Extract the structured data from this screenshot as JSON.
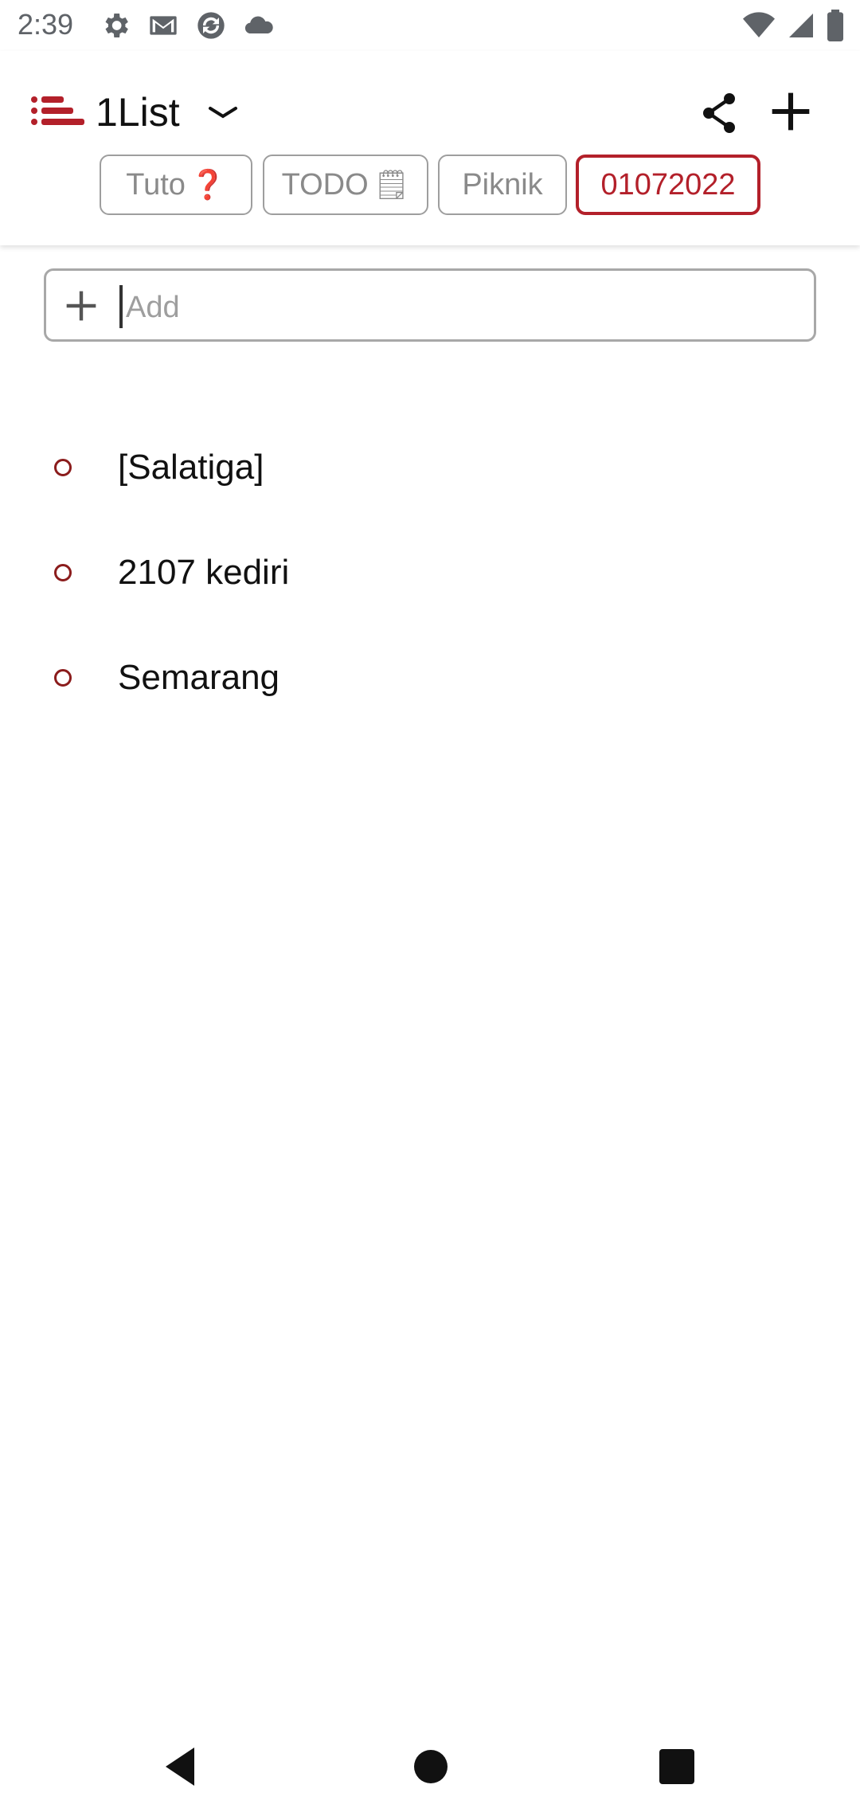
{
  "status_bar": {
    "time": "2:39",
    "icons_left": [
      "settings-icon",
      "gmail-icon",
      "sync-app-icon",
      "cloud-icon"
    ],
    "icons_right": [
      "wifi-icon",
      "signal-icon",
      "battery-icon"
    ]
  },
  "header": {
    "app_title": "1List",
    "menu_icon": "list-menu-icon",
    "accent_color": "#b3202a",
    "tabs": [
      {
        "label": "Tuto",
        "emoji": "❓",
        "active": false
      },
      {
        "label": "TODO",
        "emoji": "🗒",
        "active": false
      },
      {
        "label": "Piknik",
        "emoji": "",
        "active": false
      },
      {
        "label": "01072022",
        "emoji": "",
        "active": true
      }
    ]
  },
  "add_bar": {
    "placeholder": "Add"
  },
  "items": [
    {
      "text": "[Salatiga]"
    },
    {
      "text": "2107 kediri"
    },
    {
      "text": "Semarang"
    }
  ],
  "nav_bar": {
    "buttons": [
      "back",
      "home",
      "recents"
    ]
  }
}
